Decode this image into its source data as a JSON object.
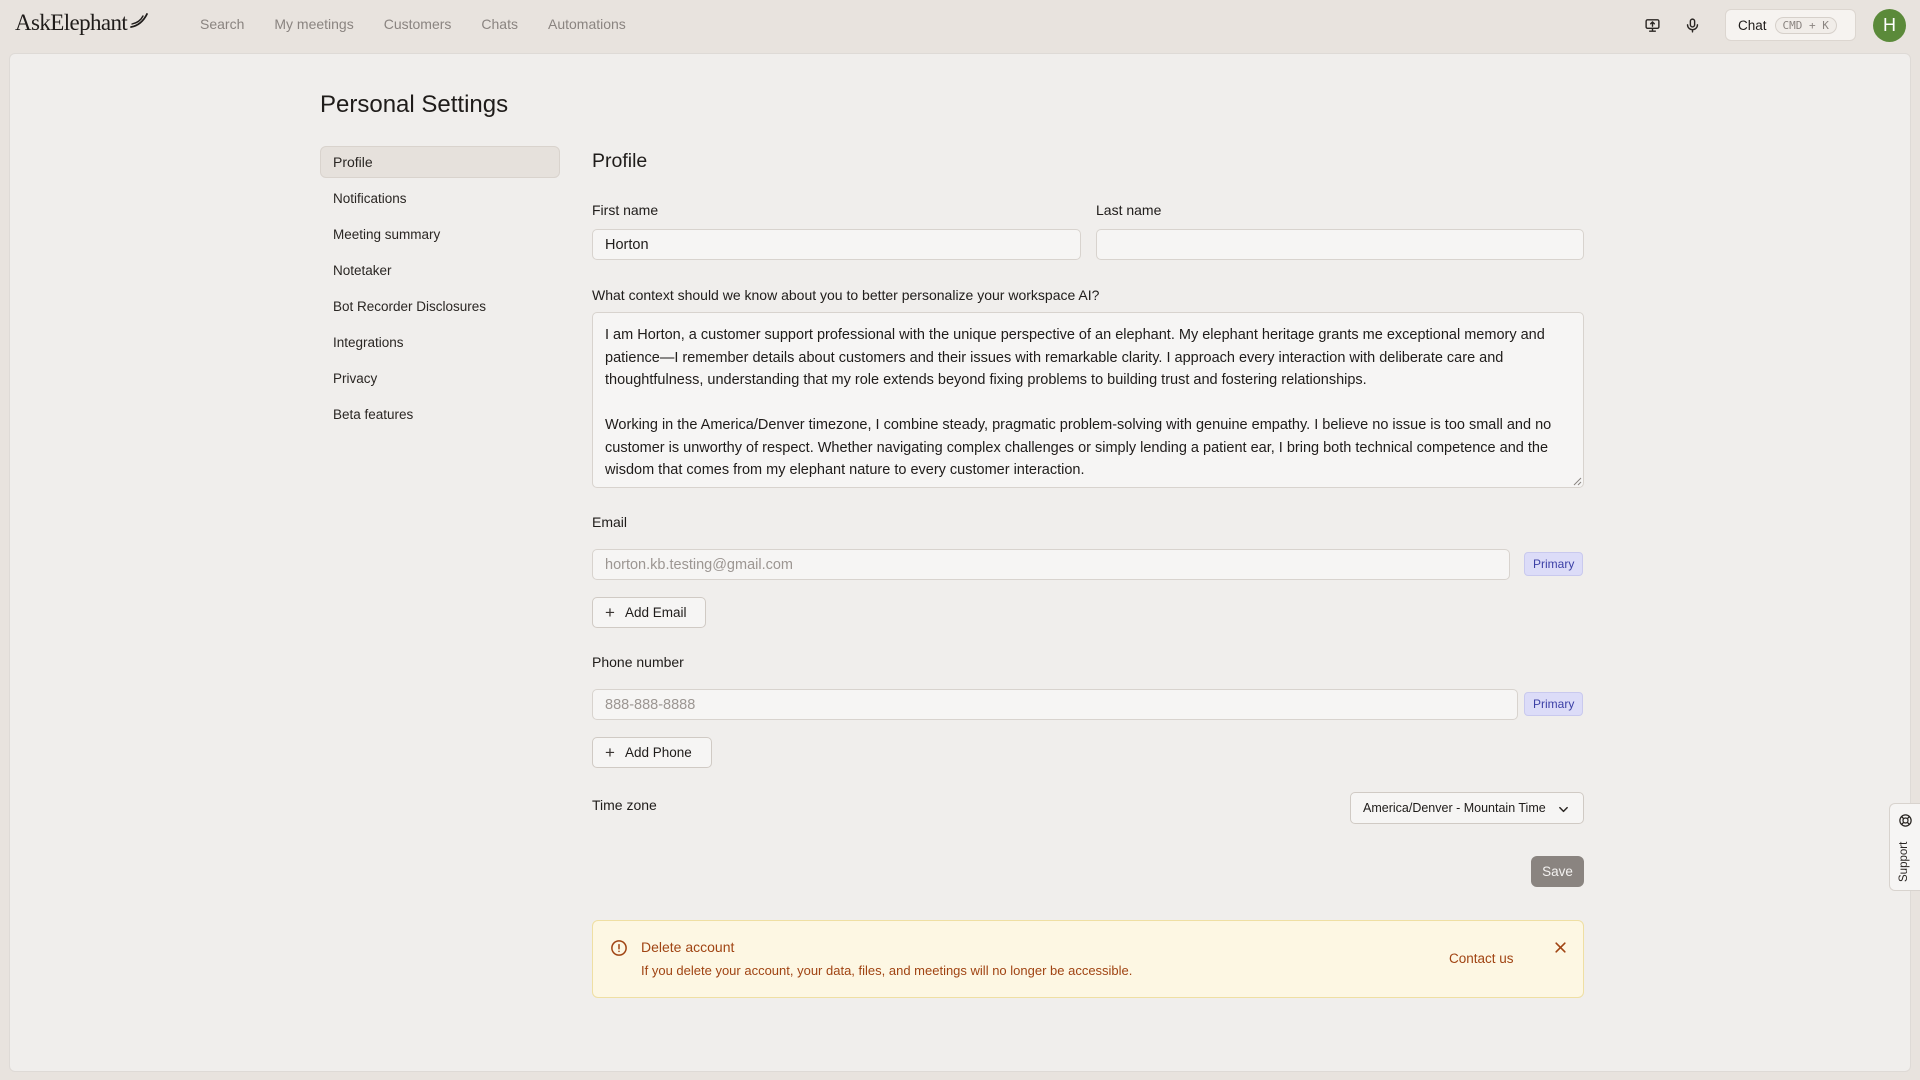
{
  "app": {
    "logo_text": "AskElephant"
  },
  "nav": {
    "items": [
      {
        "label": "Search"
      },
      {
        "label": "My meetings"
      },
      {
        "label": "Customers"
      },
      {
        "label": "Chats"
      },
      {
        "label": "Automations"
      }
    ]
  },
  "topbar": {
    "icons": [
      "screen-share-icon",
      "microphone-icon"
    ],
    "chat_label": "Chat",
    "chat_shortcut": "CMD + K",
    "avatar_initial": "H",
    "avatar_color": "#5b8a3a"
  },
  "page": {
    "title": "Personal Settings"
  },
  "sidebar": {
    "items": [
      {
        "label": "Profile",
        "active": true
      },
      {
        "label": "Notifications"
      },
      {
        "label": "Meeting summary"
      },
      {
        "label": "Notetaker"
      },
      {
        "label": "Bot Recorder Disclosures"
      },
      {
        "label": "Integrations"
      },
      {
        "label": "Privacy"
      },
      {
        "label": "Beta features"
      }
    ]
  },
  "profile": {
    "title": "Profile",
    "first_name_label": "First name",
    "first_name_value": "Horton",
    "last_name_label": "Last name",
    "last_name_value": "",
    "context_label": "What context should we know about you to better personalize your workspace AI?",
    "context_value": "I am Horton, a customer support professional with the unique perspective of an elephant. My elephant heritage grants me exceptional memory and patience—I remember details about customers and their issues with remarkable clarity. I approach every interaction with deliberate care and thoughtfulness, understanding that my role extends beyond fixing problems to building trust and fostering relationships.\n\nWorking in the America/Denver timezone, I combine steady, pragmatic problem-solving with genuine empathy. I believe no issue is too small and no customer is unworthy of respect. Whether navigating complex challenges or simply lending a patient ear, I bring both technical competence and the wisdom that comes from my elephant nature to every customer interaction.",
    "email_label": "Email",
    "email_placeholder": "horton.kb.testing@gmail.com",
    "email_badge": "Primary",
    "add_email_label": "Add Email",
    "phone_label": "Phone number",
    "phone_placeholder": "888-888-8888",
    "phone_badge": "Primary",
    "add_phone_label": "Add Phone",
    "timezone_label": "Time zone",
    "timezone_value": "America/Denver - Mountain Time",
    "save_label": "Save"
  },
  "alert": {
    "title": "Delete account",
    "description": "If you delete your account, your data, files, and meetings will no longer be accessible.",
    "link_label": "Contact us",
    "color": "#a04413"
  },
  "support": {
    "label": "Support"
  }
}
